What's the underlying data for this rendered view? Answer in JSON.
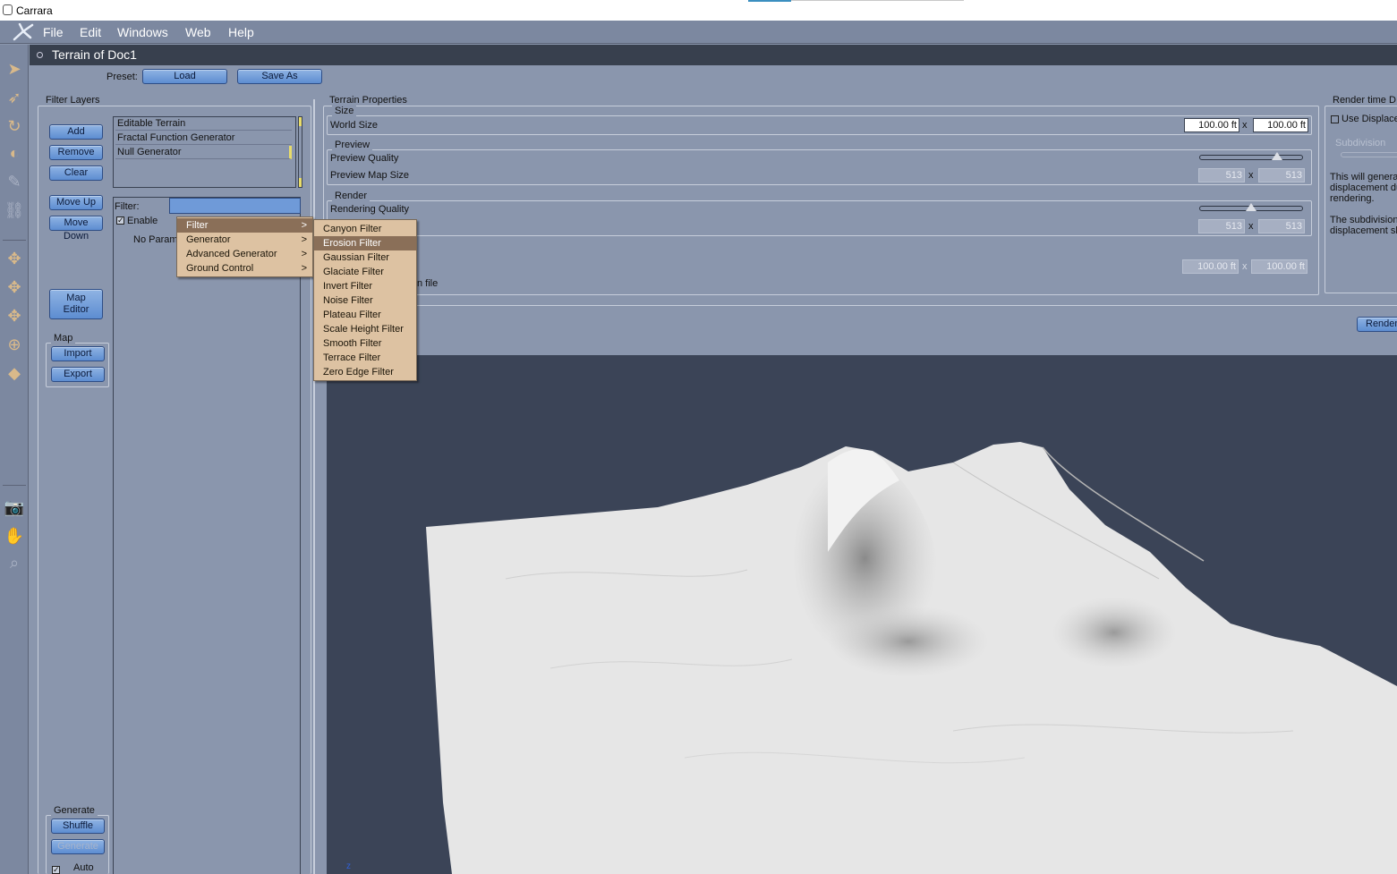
{
  "window": {
    "title": "Carrara"
  },
  "menubar": {
    "items": [
      "File",
      "Edit",
      "Windows",
      "Web",
      "Help"
    ]
  },
  "document": {
    "title": "Terrain of Doc1"
  },
  "preset": {
    "label": "Preset:",
    "load_label": "Load",
    "saveas_label": "Save As"
  },
  "filter_layers": {
    "title": "Filter Layers",
    "buttons": {
      "add": "Add",
      "remove": "Remove",
      "clear": "Clear",
      "move_up": "Move Up",
      "move_down": "Move Down",
      "map_editor_line1": "Map",
      "map_editor_line2": "Editor"
    },
    "layers": [
      "Editable Terrain",
      "Fractal Function Generator",
      "Null Generator"
    ],
    "filter_label": "Filter:",
    "enable_label": "Enable",
    "enable_checked": true,
    "no_params": "No Param"
  },
  "map_group": {
    "title": "Map",
    "import": "Import",
    "export": "Export"
  },
  "generate_group": {
    "title": "Generate",
    "shuffle": "Shuffle",
    "generate": "Generate",
    "auto": "Auto"
  },
  "terrain_properties": {
    "title": "Terrain Properties",
    "size": {
      "title": "Size",
      "world_size_label": "World Size",
      "width": "100.00 ft",
      "x": "x",
      "height": "100.00 ft"
    },
    "preview": {
      "title": "Preview",
      "quality_label": "Preview Quality",
      "quality_level": 0.78,
      "map_size_label": "Preview Map Size",
      "map_w": "513",
      "map_h": "513"
    },
    "render": {
      "title": "Render",
      "quality_label": "Rendering Quality",
      "quality_level": 0.5,
      "map_w": "513",
      "map_h": "513"
    },
    "extra": {
      "w": "100.00 ft",
      "h": "100.00 ft",
      "file_suffix": "n file"
    }
  },
  "render_time": {
    "title": "Render time D",
    "use_displace": "Use Displace",
    "subdivision": "Subdivision",
    "desc1": [
      "This will genera",
      "displacement du",
      "rendering."
    ],
    "desc2": [
      "The subdivision",
      "displacement sh"
    ],
    "render_button": "Render"
  },
  "context_menu": {
    "items": [
      {
        "label": "Filter",
        "arrow": ">"
      },
      {
        "label": "Generator",
        "arrow": ">"
      },
      {
        "label": "Advanced Generator",
        "arrow": ">"
      },
      {
        "label": "Ground Control",
        "arrow": ">"
      }
    ],
    "submenu": [
      "Canyon Filter",
      "Erosion Filter",
      "Gaussian Filter",
      "Glaciate Filter",
      "Invert Filter",
      "Noise Filter",
      "Plateau Filter",
      "Scale Height Filter",
      "Smooth Filter",
      "Terrace Filter",
      "Zero Edge Filter"
    ],
    "highlighted_submenu": "Erosion Filter"
  },
  "viewport": {
    "axis_label": "z"
  },
  "colors": {
    "panel": "#8a96ad",
    "button": "#6f9ad8",
    "menu": "#ddc2a2",
    "menu_highlight": "#8a6f58",
    "viewport": "#3b4457"
  }
}
